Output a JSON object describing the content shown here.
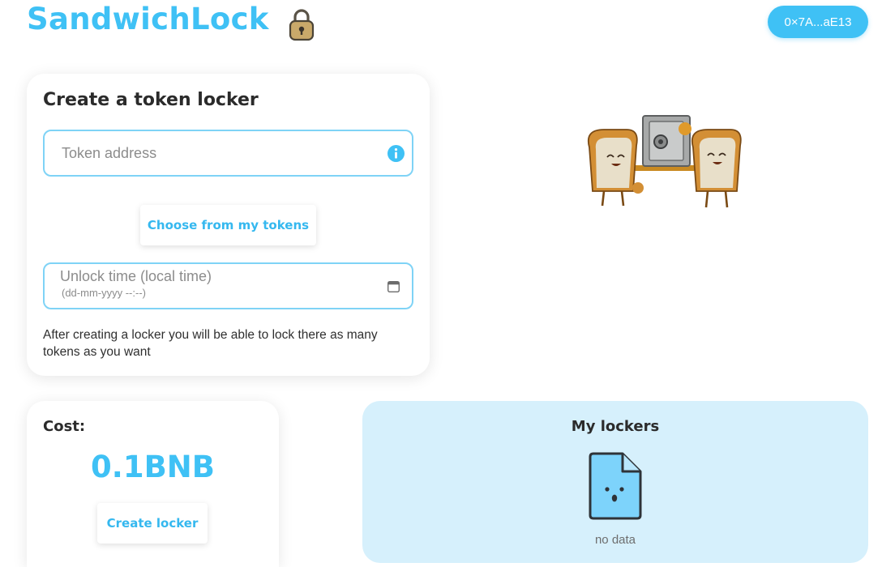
{
  "header": {
    "app_name": "SandwichLock",
    "wallet_address": "0×7A...aE13",
    "lock_icon": "padlock-icon"
  },
  "create_card": {
    "title": "Create a token locker",
    "token_placeholder": "Token address",
    "token_icon": "info-icon",
    "choose_button": "Choose from my tokens",
    "unlock_label": "Unlock time (local time)",
    "unlock_hint": "(dd-mm-yyyy --:--)",
    "unlock_icon": "calendar-icon",
    "note": "After creating a locker you will be able to lock there as many tokens as you want"
  },
  "cost_card": {
    "label": "Cost:",
    "value": "0.1BNB",
    "create_button": "Create locker"
  },
  "lockers_card": {
    "title": "My lockers",
    "empty_icon": "empty-file-icon",
    "empty_text": "no data"
  },
  "colors": {
    "accent": "#3fc1f5",
    "field_border": "#7fd3f6",
    "lockers_bg": "#d6f0fc",
    "text": "#2b2b2b"
  }
}
